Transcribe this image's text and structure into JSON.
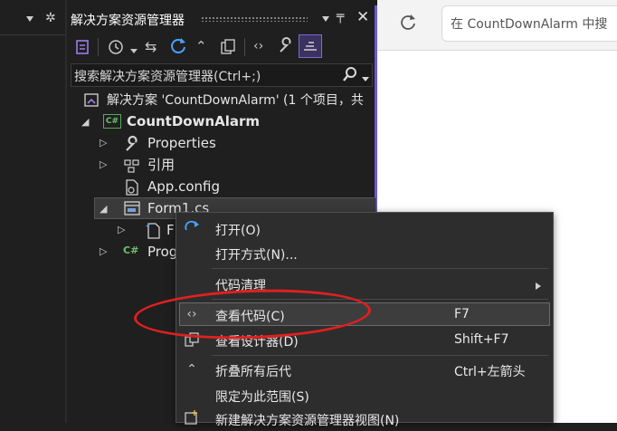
{
  "left_panel": {
    "dropdown_icon": "triangle-down-icon",
    "settings_icon": "gear-icon"
  },
  "solution_explorer": {
    "title": "解决方案资源管理器",
    "search_placeholder": "搜索解决方案资源管理器(Ctrl+;)",
    "tree": {
      "solution": "解决方案 'CountDownAlarm' (1 个项目，共",
      "project": "CountDownAlarm",
      "properties": "Properties",
      "references": "引用",
      "app_config": "App.config",
      "form1": "Form1.cs",
      "form1_child": "F",
      "program": "Prog",
      "csharp_badge": "C#"
    }
  },
  "browser": {
    "address_placeholder": "在 CountDownAlarm 中搜"
  },
  "context_menu": {
    "items": [
      {
        "label": "打开(O)",
        "shortcut": ""
      },
      {
        "label": "打开方式(N)...",
        "shortcut": ""
      },
      {
        "label": "代码清理",
        "shortcut": ""
      },
      {
        "label": "查看代码(C)",
        "shortcut": "F7"
      },
      {
        "label": "查看设计器(D)",
        "shortcut": "Shift+F7"
      },
      {
        "label": "折叠所有后代",
        "shortcut": "Ctrl+左箭头"
      },
      {
        "label": "限定为此范围(S)",
        "shortcut": ""
      },
      {
        "label": "新建解决方案资源管理器视图(N)",
        "shortcut": ""
      }
    ]
  },
  "colors": {
    "accent": "#6d5bd0",
    "highlight_ellipse": "#e02020"
  }
}
